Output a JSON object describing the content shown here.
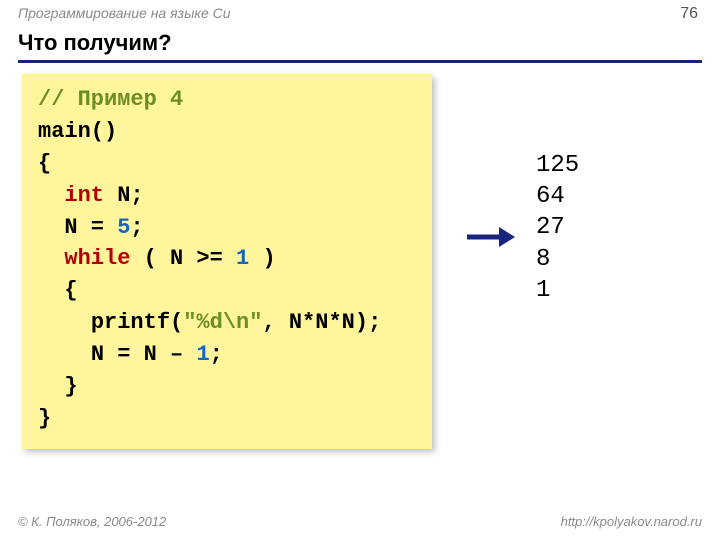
{
  "header": {
    "course": "Программирование на языке Си",
    "page": "76",
    "title": "Что получим?"
  },
  "code": {
    "comment": "// Пример 4",
    "l1a": "main()",
    "l2": "{",
    "l3_kw": "int",
    "l3_rest": " N;",
    "l4_a": "N = ",
    "l4_num": "5",
    "l4_b": ";",
    "l5_kw": "while",
    "l5_a": " ( N",
    "l5_op": " >= ",
    "l5_num": "1",
    "l5_b": " )",
    "l6": "{",
    "l7_a": "printf(",
    "l7_str": "\"%d\\n\"",
    "l7_b": ", N*N*N);",
    "l8_a": "N = N",
    "l8_op": " – ",
    "l8_num": "1",
    "l8_b": ";",
    "l9": "}",
    "l10": "}"
  },
  "output": {
    "v1": "125",
    "v2": "64",
    "v3": "27",
    "v4": "8",
    "v5": "1"
  },
  "footer": {
    "copyright": "© К. Поляков, 2006-2012",
    "url": "http://kpolyakov.narod.ru"
  }
}
